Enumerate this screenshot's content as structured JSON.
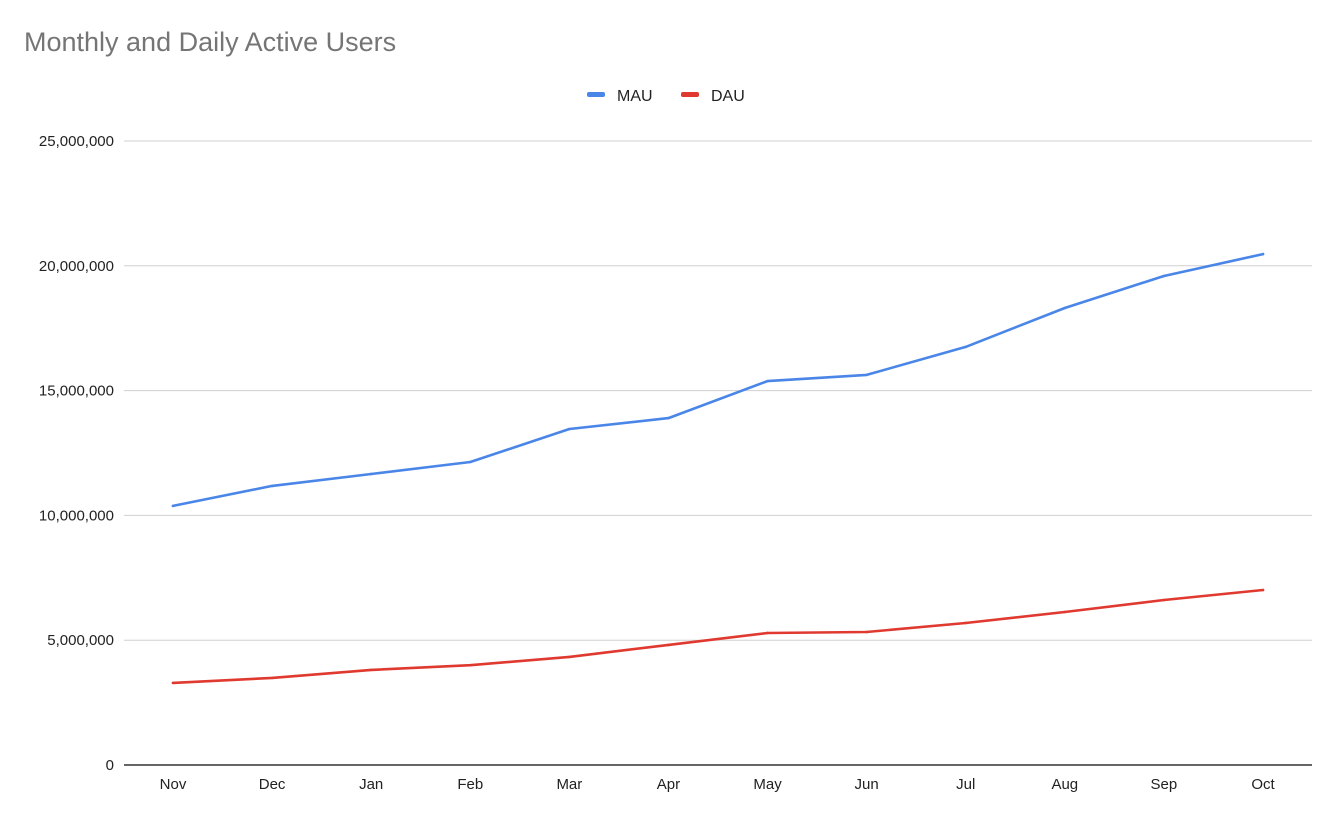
{
  "chart_data": {
    "type": "line",
    "title": "Monthly and Daily Active Users",
    "xlabel": "",
    "ylabel": "",
    "categories": [
      "Nov",
      "Dec",
      "Jan",
      "Feb",
      "Mar",
      "Apr",
      "May",
      "Jun",
      "Jul",
      "Aug",
      "Sep",
      "Oct"
    ],
    "ylim": [
      0,
      25000000
    ],
    "yticks": [
      0,
      5000000,
      10000000,
      15000000,
      20000000,
      25000000
    ],
    "ytick_labels": [
      "0",
      "5,000,000",
      "10,000,000",
      "15,000,000",
      "20,000,000",
      "25,000,000"
    ],
    "grid": true,
    "legend_position": "top-center",
    "series": [
      {
        "name": "MAU",
        "color": "#4a86e8",
        "values": [
          10380000,
          11180000,
          11660000,
          12140000,
          13460000,
          13900000,
          15380000,
          15630000,
          16750000,
          18310000,
          19590000,
          20470000
        ]
      },
      {
        "name": "DAU",
        "color": "#e0392f",
        "values": [
          3290000,
          3490000,
          3810000,
          4000000,
          4330000,
          4810000,
          5290000,
          5330000,
          5690000,
          6130000,
          6610000,
          7010000
        ]
      }
    ]
  }
}
